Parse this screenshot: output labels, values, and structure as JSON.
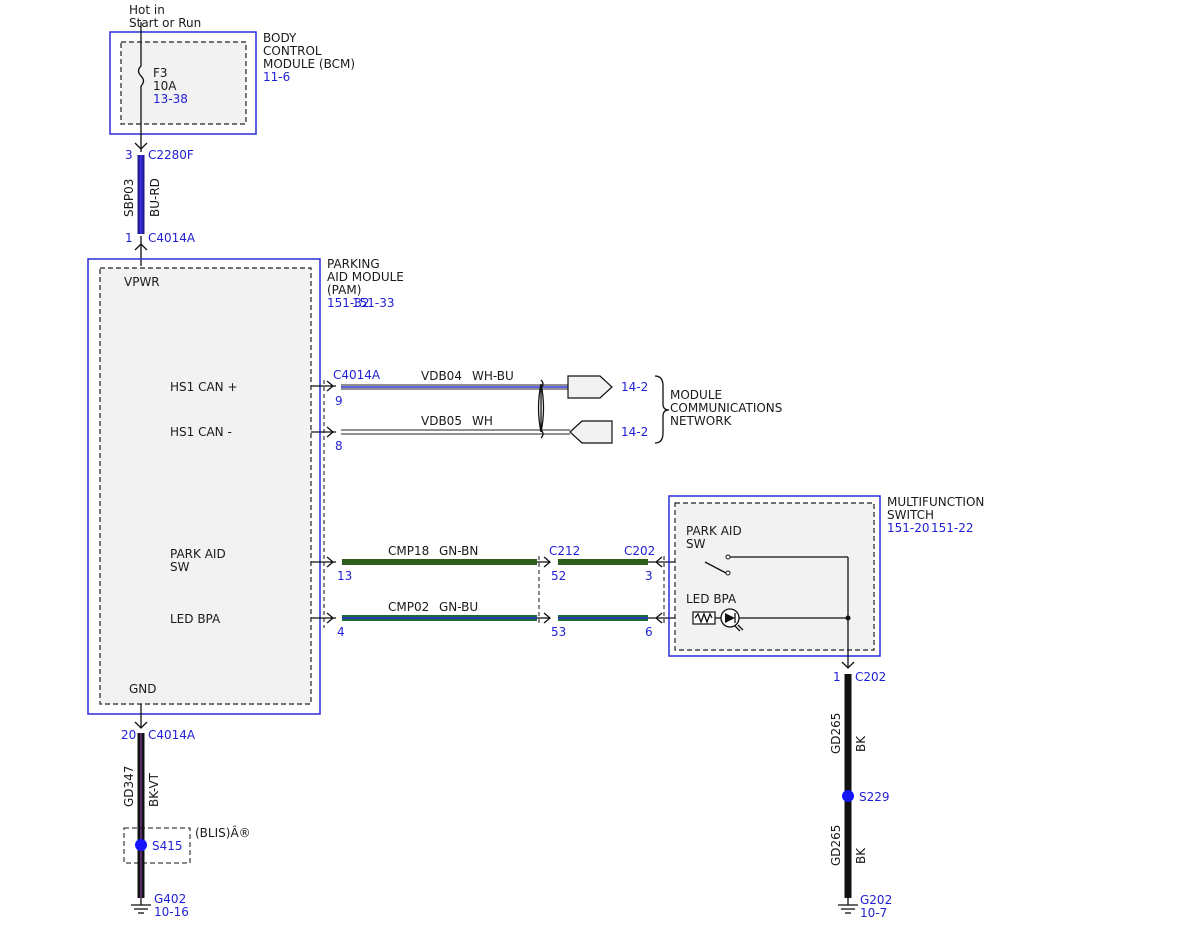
{
  "bcm": {
    "hot_line1": "Hot in",
    "hot_line2": "Start or Run",
    "name_line1": "BODY",
    "name_line2": "CONTROL",
    "name_line3": "MODULE (BCM)",
    "ref": "11-6",
    "fuse_name": "F3",
    "fuse_rating": "10A",
    "fuse_ref": "13-38"
  },
  "wire_sbp03": {
    "pin_top": "3",
    "connector_top": "C2280F",
    "circuit": "SBP03",
    "color": "BU-RD",
    "pin_bottom": "1",
    "connector_bottom": "C4014A"
  },
  "pam": {
    "name_line1": "PARKING",
    "name_line2": "AID MODULE",
    "name_line3": "(PAM)",
    "ref1": "151-32",
    "ref2": "151-33",
    "vpwr": "VPWR",
    "hs1_can_plus": "HS1 CAN +",
    "hs1_can_minus": "HS1 CAN -",
    "park_aid_sw_line1": "PARK AID",
    "park_aid_sw_line2": "SW",
    "led_bpa": "LED BPA",
    "gnd": "GND"
  },
  "can": {
    "connector": "C4014A",
    "plus": {
      "pin": "9",
      "circuit": "VDB04",
      "color": "WH-BU",
      "ref": "14-2"
    },
    "minus": {
      "pin": "8",
      "circuit": "VDB05",
      "color": "WH",
      "ref": "14-2"
    },
    "network_line1": "MODULE",
    "network_line2": "COMMUNICATIONS",
    "network_line3": "NETWORK"
  },
  "cmp18": {
    "pin_pam": "13",
    "circuit": "CMP18",
    "color": "GN-BN",
    "connector_mid": "C212",
    "pin_mid": "52",
    "connector_switch": "C202",
    "pin_switch": "3"
  },
  "cmp02": {
    "pin_pam": "4",
    "circuit": "CMP02",
    "color": "GN-BU",
    "pin_mid": "53",
    "pin_switch": "6"
  },
  "mfs": {
    "name_line1": "MULTIFUNCTION",
    "name_line2": "SWITCH",
    "ref1": "151-20",
    "ref2": "151-22",
    "park_aid_sw_line1": "PARK AID",
    "park_aid_sw_line2": "SW",
    "led_bpa": "LED BPA"
  },
  "gd265": {
    "pin": "1",
    "connector": "C202",
    "circuit_upper": "GD265",
    "color_upper": "BK",
    "splice": "S229",
    "circuit_lower": "GD265",
    "color_lower": "BK",
    "ground": "G202",
    "ground_ref": "10-7"
  },
  "gd347": {
    "pin": "20",
    "connector": "C4014A",
    "circuit": "GD347",
    "color": "BK-VT",
    "option_label": "(BLIS)Â®",
    "splice": "S415",
    "ground": "G402",
    "ground_ref": "10-16"
  },
  "colors": {
    "bu_rd_outer": "#1a1a8c",
    "bu_rd_inner": "#3a2ad6",
    "gn_bn": "#2e5e1a",
    "gn_bu": "#1c6b3a",
    "bk": "#111111",
    "bk_vt_inner": "#5a2a6a",
    "ref_blue": "#1f1fd6",
    "splice_dot": "#1414ff"
  }
}
